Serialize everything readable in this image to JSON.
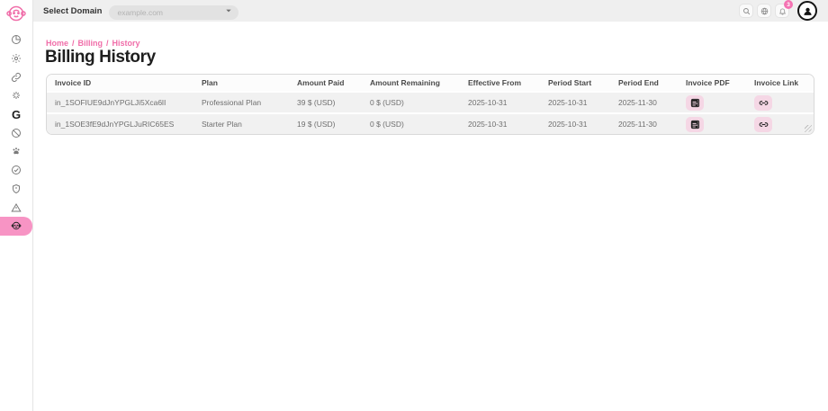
{
  "header": {
    "select_domain_label": "Select Domain",
    "domain_placeholder": "example.com",
    "domain_value": "",
    "notification_count": "3"
  },
  "breadcrumb": {
    "items": [
      "Home",
      "Billing",
      "History"
    ],
    "separator": "/"
  },
  "page": {
    "title": "Billing History"
  },
  "sidebar": {
    "items": [
      "pie-chart",
      "gear",
      "link",
      "sparkle",
      "google",
      "block",
      "paw",
      "verified",
      "shield",
      "warning",
      "monkey-billing"
    ],
    "active_item": "monkey-billing",
    "google_label": "G"
  },
  "colors": {
    "accent_pink": "#f06ea9",
    "active_pink": "#f794c4",
    "button_pink": "#f5d7e5",
    "badge_pink": "#f472b2",
    "topbar_gray": "#efefef",
    "row_gray": "#f1f1f1"
  },
  "table": {
    "columns": [
      "Invoice ID",
      "Plan",
      "Amount Paid",
      "Amount Remaining",
      "Effective From",
      "Period Start",
      "Period End",
      "Invoice PDF",
      "Invoice Link"
    ],
    "rows": [
      {
        "invoice_id": "in_1SOFIUE9dJnYPGLJi5Xca6lI",
        "plan": "Professional Plan",
        "amount_paid": "39 $ (USD)",
        "amount_remaining": "0 $ (USD)",
        "effective_from": "2025-10-31",
        "period_start": "2025-10-31",
        "period_end": "2025-11-30",
        "pdf_icon": "pdf-file-icon",
        "link_icon": "invoice-link-icon"
      },
      {
        "invoice_id": "in_1SOE3fE9dJnYPGLJuRIC65ES",
        "plan": "Starter Plan",
        "amount_paid": "19 $ (USD)",
        "amount_remaining": "0 $ (USD)",
        "effective_from": "2025-10-31",
        "period_start": "2025-10-31",
        "period_end": "2025-11-30",
        "pdf_icon": "pdf-file-icon",
        "link_icon": "invoice-link-icon"
      }
    ]
  }
}
